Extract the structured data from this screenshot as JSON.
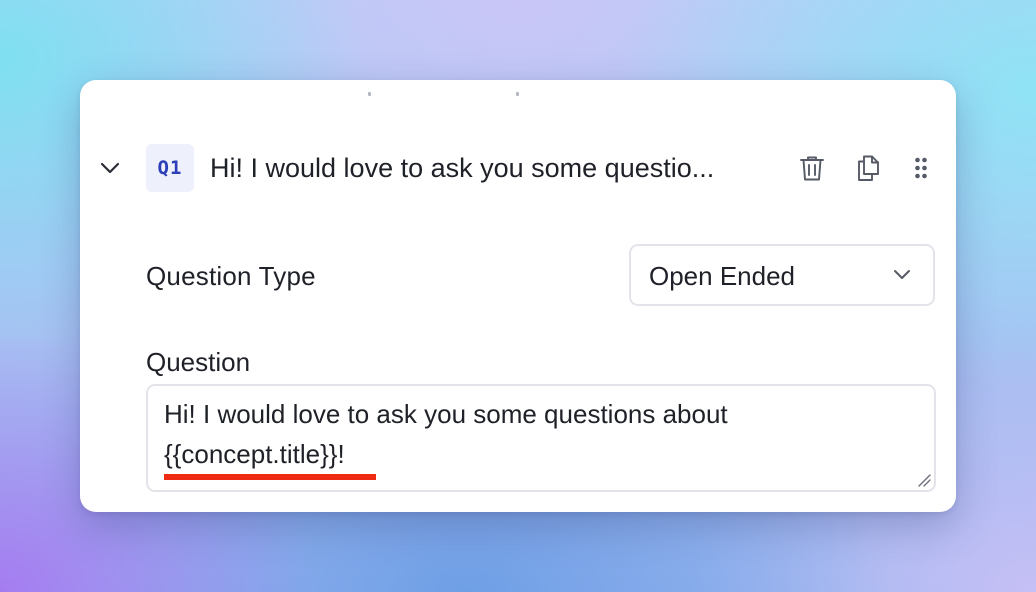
{
  "question": {
    "number_badge": "Q1",
    "title_truncated": "Hi! I would love to ask you some questio...",
    "icons": {
      "collapse": "chevron-down-icon",
      "delete": "trash-icon",
      "duplicate": "copy-icon",
      "drag": "drag-handle-icon"
    }
  },
  "question_type": {
    "label": "Question Type",
    "selected": "Open Ended"
  },
  "question_field": {
    "label": "Question",
    "line1": "Hi! I would love to ask you some questions about",
    "variable": "{{concept.title}}",
    "suffix": "!",
    "underline_color": "#ee2a13"
  },
  "colors": {
    "badge_bg": "#eef0fb",
    "badge_text": "#2c3fb8",
    "text": "#1f2128",
    "border": "#e2e4ea"
  }
}
